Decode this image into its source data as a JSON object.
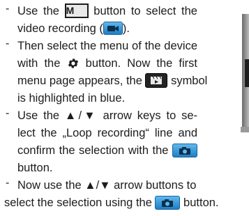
{
  "steps": [
    {
      "line1": {
        "a": "Use the ",
        "b": " button to select the"
      },
      "line2": {
        "a": "video recording (",
        "b": ")."
      }
    },
    {
      "line1": "Then select the menu of the device",
      "line2": {
        "a": "with the ",
        "b": " button. Now the first"
      },
      "line3": {
        "a": "menu page appears, the ",
        "b": " symbol"
      },
      "line4": "is highlighted in blue."
    },
    {
      "line1": "Use the ▲/▼ arrow keys to se-",
      "line2": "lect the „Loop recording“ line and",
      "line3": {
        "a": "confirm the selection with the ",
        "b": ""
      },
      "line4": "button."
    },
    {
      "line1": "Now use the ▲/▼ arrow buttons to",
      "line2": {
        "a": "select the selection using the ",
        "b": " button."
      }
    }
  ],
  "icons": {
    "mode_button_letter": "M",
    "mode_button": "mode-m-button-icon",
    "video": "video-camera-icon",
    "settings": "gear-icon",
    "menu_symbol": "film-clapper-icon",
    "photo": "photo-camera-icon"
  },
  "colors": {
    "text": "#1c1c1c",
    "icon_blue": "#2b8fd6",
    "icon_blue_dark": "#17639a",
    "gear": "#1c1c1c",
    "film_icon": "#242424"
  }
}
